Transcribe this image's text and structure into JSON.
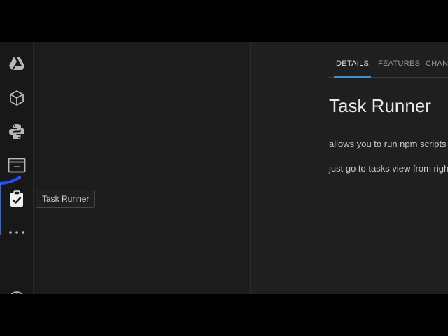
{
  "activity_bar": {
    "icons": [
      "google-drive-icon",
      "cube-icon",
      "python-icon",
      "terminal-window-icon",
      "clipboard-check-icon",
      "more-icon",
      "account-icon"
    ],
    "colors": {
      "icon": "#b8b8b8",
      "active_icon": "#f0f0f0",
      "active_indicator": "#1f6bff"
    }
  },
  "tooltip": {
    "text": "Task Runner"
  },
  "extension": {
    "tabs": [
      {
        "label": "DETAILS"
      },
      {
        "label": "FEATURES"
      },
      {
        "label": "CHANG"
      }
    ],
    "title": "Task Runner",
    "description": [
      "allows you to run npm scripts",
      "just go to tasks view from righ"
    ],
    "colors": {
      "tab_active_underline": "#3e8ed0"
    }
  }
}
